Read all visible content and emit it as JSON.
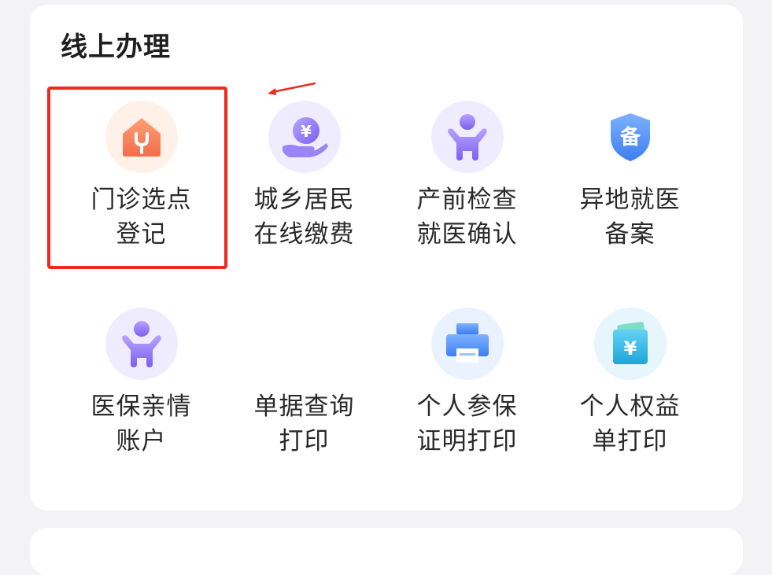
{
  "section": {
    "title": "线上办理"
  },
  "tiles": [
    {
      "id": "menzhen",
      "line1": "门诊选点",
      "line2": "登记",
      "icon": "house-stethoscope-icon",
      "color": "#f7875a"
    },
    {
      "id": "jiaofei",
      "line1": "城乡居民",
      "line2": "在线缴费",
      "icon": "yuan-hand-icon",
      "color": "#8b74f0"
    },
    {
      "id": "chanqian",
      "line1": "产前检查",
      "line2": "就医确认",
      "icon": "child-figure-icon",
      "color": "#8b74f0"
    },
    {
      "id": "beian",
      "line1": "异地就医",
      "line2": "备案",
      "icon": "shield-bei-icon",
      "color": "#4c8cf5"
    },
    {
      "id": "qinqing",
      "line1": "医保亲情",
      "line2": "账户",
      "icon": "child-figure-icon",
      "color": "#8b74f0"
    },
    {
      "id": "danju",
      "line1": "单据查询",
      "line2": "打印",
      "icon": "",
      "color": ""
    },
    {
      "id": "canbao",
      "line1": "个人参保",
      "line2": "证明打印",
      "icon": "printer-icon",
      "color": "#4c8cf5"
    },
    {
      "id": "quanyi",
      "line1": "个人权益",
      "line2": "单打印",
      "icon": "wallet-yuan-icon",
      "color": "#2fb7e4"
    }
  ],
  "icon_glyphs": {
    "yuan": "¥",
    "bei": "备"
  }
}
